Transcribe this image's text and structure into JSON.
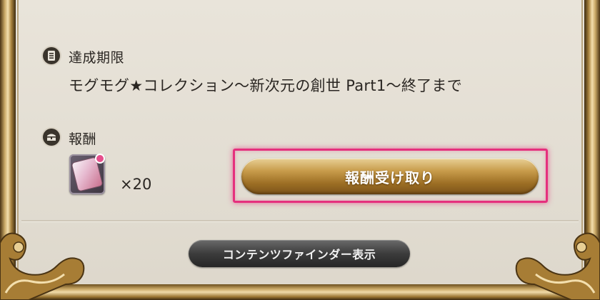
{
  "deadline": {
    "icon": "document-icon",
    "label": "達成期限",
    "text": "モグモグ★コレクション～新次元の創世 Part1～終了まで"
  },
  "reward": {
    "icon": "treasure-chest-icon",
    "label": "報酬",
    "item_icon": "tomestone-card-icon",
    "quantity": "×20"
  },
  "buttons": {
    "claim_label": "報酬受け取り",
    "content_finder_label": "コンテンツファインダー表示"
  },
  "colors": {
    "highlight": "#e5307d",
    "claim_button": "#c79b4a",
    "finder_button": "#3c3c3c"
  }
}
